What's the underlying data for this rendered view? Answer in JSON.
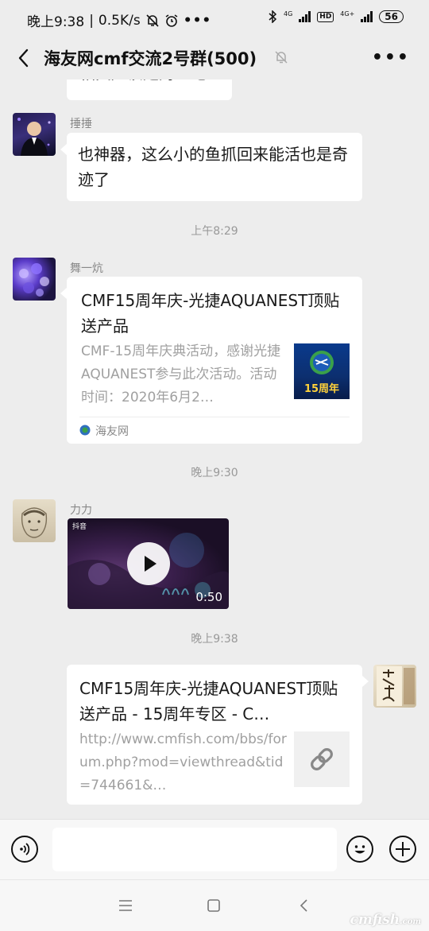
{
  "status_bar": {
    "time": "晚上9:38",
    "speed": "0.5K/s",
    "net1": "4G",
    "hd": "HD",
    "net2": "4G+",
    "battery": "56"
  },
  "header": {
    "title": "海友网cmf交流2号群(500)"
  },
  "messages": [
    {
      "type": "text",
      "text": "相关应该是对立吧"
    },
    {
      "type": "text",
      "sender": "捶捶",
      "text": "也神器，这么小的鱼抓回来能活也是奇迹了"
    },
    {
      "type": "time",
      "text": "上午8:29"
    },
    {
      "type": "link-card",
      "sender": "舞一炕",
      "title": "CMF15周年庆-光捷AQUANEST顶贴送产品",
      "desc": "CMF-15周年庆典活动，感谢光捷AQUANEST参与此次活动。活动时间：2020年6月2…",
      "thumb_text": "15周年",
      "source": "海友网"
    },
    {
      "type": "time",
      "text": "晚上9:30"
    },
    {
      "type": "video",
      "sender": "力力",
      "duration": "0:50",
      "badge": "抖音"
    },
    {
      "type": "time",
      "text": "晚上9:38"
    },
    {
      "type": "link-card-self",
      "title": "CMF15周年庆-光捷AQUANEST顶贴送产品 - 15周年专区 - C…",
      "desc": "http://www.cmfish.com/bbs/forum.php?mod=viewthread&tid=744661&…"
    }
  ],
  "watermark": {
    "text": "cmfish",
    "suffix": ".com"
  },
  "colors": {
    "bg": "#ededed",
    "bubble": "#ffffff",
    "accent": "#07c160"
  },
  "icons": [
    "back-icon",
    "mute-icon",
    "more-icon",
    "play-icon",
    "link-icon",
    "voice-icon",
    "emoji-icon",
    "plus-icon",
    "menu-icon",
    "home-icon",
    "back-nav-icon"
  ]
}
